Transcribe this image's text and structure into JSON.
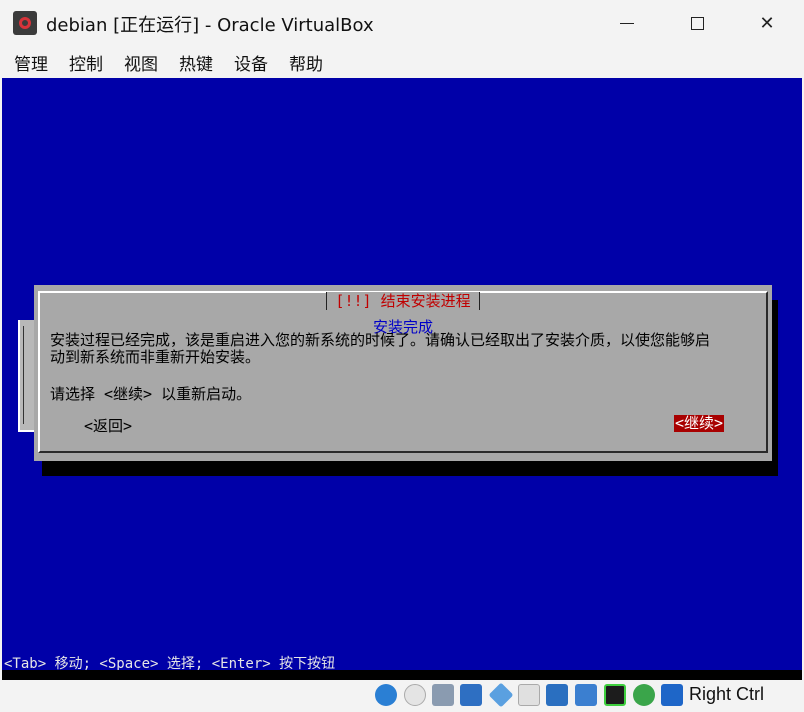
{
  "window": {
    "title": "debian [正在运行] - Oracle VirtualBox",
    "controls": {
      "minimize": "minimize",
      "maximize": "maximize",
      "close": "✕"
    }
  },
  "menu": [
    "管理",
    "控制",
    "视图",
    "热键",
    "设备",
    "帮助"
  ],
  "installer": {
    "dialog_title": "[!!] 结束安装进程",
    "subtitle": "安装完成",
    "message_line1": "安装过程已经完成，该是重启进入您的新系统的时候了。请确认已经取出了安装介质，以使您能够启",
    "message_line2": "动到新系统而非重新开始安装。",
    "prompt": "请选择 <继续> 以重新启动。",
    "back_button": "<返回>",
    "continue_button": "<继续>",
    "hint": "<Tab> 移动; <Space> 选择; <Enter> 按下按钮"
  },
  "statusbar": {
    "icons": [
      "hard-disk-icon",
      "optical-drive-icon",
      "audio-icon",
      "network-icon",
      "usb-icon",
      "shared-folders-icon",
      "display-icon",
      "recording-icon",
      "cpu-icon",
      "mouse-integration-icon",
      "keyboard-icon"
    ],
    "host_key": "Right Ctrl"
  },
  "colors": {
    "vm_background": "#0000a8",
    "dialog_background": "#a8a8a8",
    "title_red": "#c00000",
    "subtitle_blue": "#0000c8",
    "selected_button": "#a80000"
  }
}
